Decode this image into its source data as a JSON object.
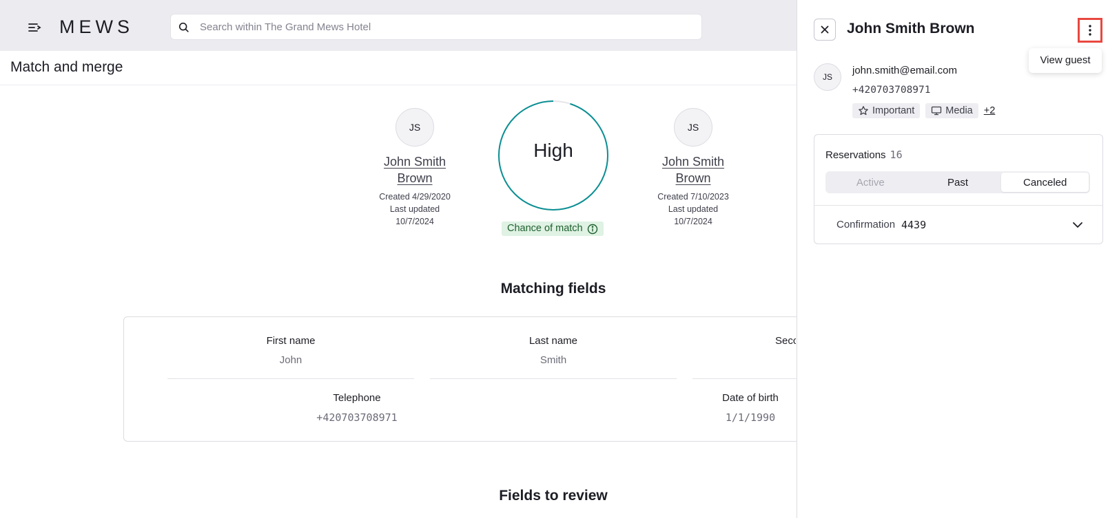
{
  "header": {
    "logo": "MEWS",
    "search_placeholder": "Search within The Grand Mews Hotel"
  },
  "page": {
    "title": "Match and merge"
  },
  "match": {
    "left_profile": {
      "initials": "JS",
      "name_line1": "John Smith",
      "name_line2": "Brown",
      "created": "Created 4/29/2020",
      "updated_label": "Last updated",
      "updated_date": "10/7/2024"
    },
    "right_profile": {
      "initials": "JS",
      "name_line1": "John Smith",
      "name_line2": "Brown",
      "created": "Created 7/10/2023",
      "updated_label": "Last updated",
      "updated_date": "10/7/2024"
    },
    "score_label": "High",
    "score_fraction": 0.95,
    "chance_label": "Chance of match",
    "accent_color": "#0a8f93"
  },
  "matching_fields": {
    "title": "Matching fields",
    "row1": [
      {
        "label": "First name",
        "value": "John"
      },
      {
        "label": "Last name",
        "value": "Smith"
      },
      {
        "label": "Secc",
        "value": ""
      }
    ],
    "row2": [
      {
        "label": "Telephone",
        "value": "+420703708971"
      },
      {
        "label": "Date of birth",
        "value": "1/1/1990"
      }
    ]
  },
  "fields_to_review": {
    "title": "Fields to review"
  },
  "panel": {
    "title": "John Smith Brown",
    "tooltip": "View guest",
    "initials": "JS",
    "email": "john.smith@email.com",
    "phone": "+420703708971",
    "tags": [
      {
        "label": "Important",
        "icon": "star-icon"
      },
      {
        "label": "Media",
        "icon": "presentation-icon"
      }
    ],
    "more_tags": "+2",
    "reservations": {
      "label": "Reservations",
      "count": "16",
      "tabs": [
        "Active",
        "Past",
        "Canceled"
      ],
      "selected_tab": "Canceled",
      "confirmation_label": "Confirmation",
      "confirmation_value": "4439"
    }
  }
}
